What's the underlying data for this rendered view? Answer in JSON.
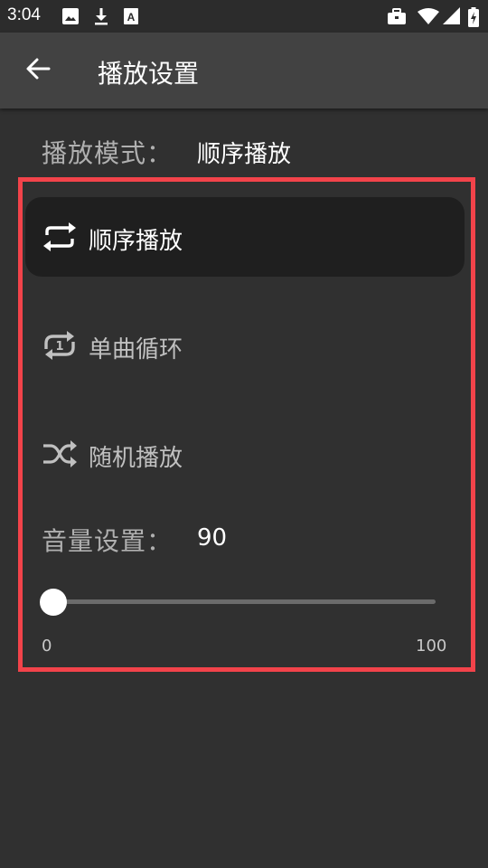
{
  "status_bar": {
    "time": "3:04",
    "icons": [
      "image-icon",
      "download-icon",
      "font-icon",
      "briefcase-icon",
      "wifi-icon",
      "signal-icon",
      "battery-icon"
    ]
  },
  "app_bar": {
    "title": "播放设置",
    "back_icon": "arrow-left-icon"
  },
  "play_mode": {
    "label": "播放模式：",
    "current": "顺序播放",
    "options": [
      {
        "label": "顺序播放",
        "icon": "repeat-icon",
        "selected": true
      },
      {
        "label": "单曲循环",
        "icon": "repeat-one-icon",
        "selected": false
      },
      {
        "label": "随机播放",
        "icon": "shuffle-icon",
        "selected": false
      }
    ]
  },
  "volume": {
    "label": "音量设置：",
    "value": "90",
    "slider_min": "0",
    "slider_max": "100",
    "slider_level": 0
  },
  "colors": {
    "background": "#303030",
    "app_bar": "#424242",
    "selected_option": "#1f1f1f",
    "highlight_border": "#f2434a"
  }
}
